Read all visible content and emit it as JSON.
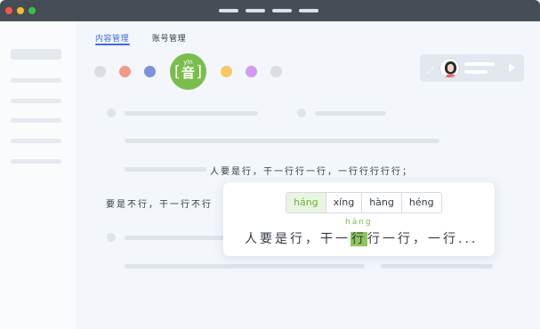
{
  "tabs": [
    {
      "label": "内容管理",
      "active": true
    },
    {
      "label": "账号管理",
      "active": false
    }
  ],
  "app_icon": {
    "pinyin": "yīn",
    "character": "音"
  },
  "colors": {
    "accent": "#3d6ae0",
    "green": "#7bbd4d",
    "dot_colors": [
      "#d9dde3",
      "#ee9d84",
      "#7d92db",
      "#f8c766",
      "#d49af0",
      "#d9dde3"
    ]
  },
  "text_lines": {
    "line1": "人要是行，干一行行一行，一行行行行行；",
    "line2": "要是不行，干一行不行"
  },
  "popup": {
    "options": [
      "háng",
      "xíng",
      "hàng",
      "héng"
    ],
    "selected_index": 0,
    "pinyin_above": "háng",
    "sentence_before": "人要是行，干一",
    "sentence_highlight": "行",
    "sentence_after": "行一行，一行..."
  },
  "icons": {
    "expand": "expand-icon",
    "play": "play-icon",
    "avatar": "avatar"
  }
}
